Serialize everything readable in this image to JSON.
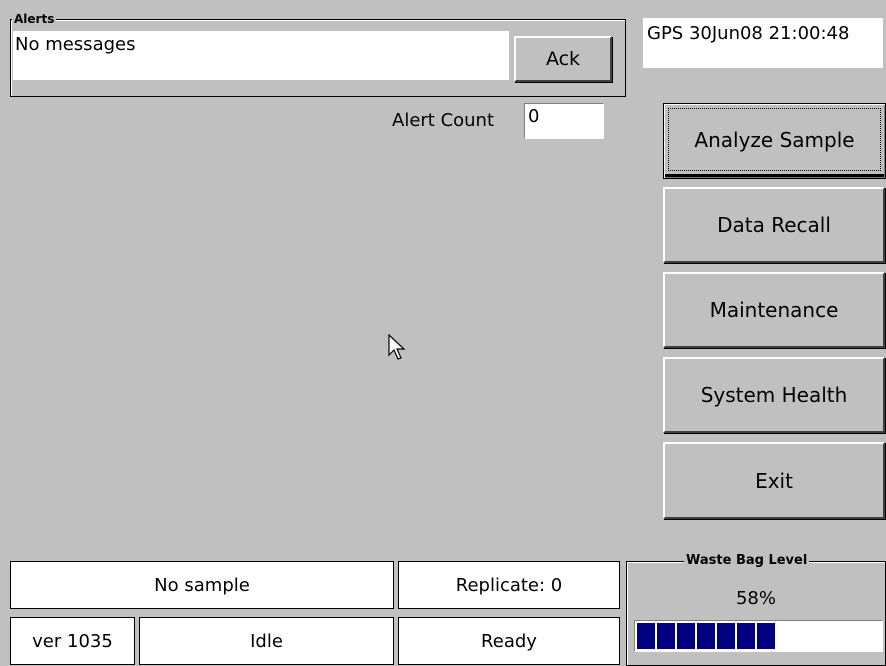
{
  "alerts": {
    "group_label": "Alerts",
    "message": "No messages",
    "ack_label": "Ack"
  },
  "gps": {
    "text": "GPS 30Jun08 21:00:48"
  },
  "alert_count": {
    "label": "Alert Count",
    "value": "0"
  },
  "menu": {
    "analyze_label": "Analyze Sample",
    "recall_label": "Data Recall",
    "maintenance_label": "Maintenance",
    "health_label": "System Health",
    "exit_label": "Exit"
  },
  "status": {
    "sample": "No sample",
    "replicate": "Replicate: 0",
    "version": "ver 1035",
    "state": "Idle",
    "ready": "Ready"
  },
  "waste": {
    "label": "Waste Bag Level",
    "percent_text": "58%",
    "level": 0.58
  },
  "colors": {
    "background": "#c0c0c0",
    "progress_fill": "#000080"
  }
}
